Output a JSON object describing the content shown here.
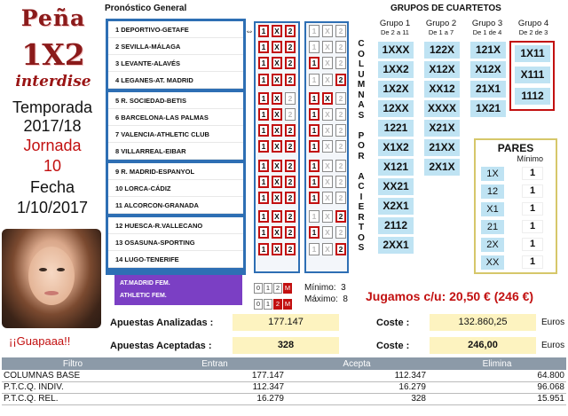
{
  "brand": {
    "line1": "Peña",
    "line2": "1X2",
    "line3": "interdise"
  },
  "info": {
    "temporada_label": "Temporada",
    "temporada": "2017/18",
    "jornada_label": "Jornada",
    "jornada": "10",
    "fecha_label": "Fecha",
    "fecha": "1/10/2017"
  },
  "guapa": "¡¡Guapaaa!!",
  "pronostico": {
    "title": "Pronóstico General",
    "matches": [
      "1  DEPORTIVO-GETAFE",
      "2  SEVILLA-MÁLAGA",
      "3  LEVANTE-ALAVÉS",
      "4  LEGANES-AT. MADRID",
      "5  R. SOCIEDAD-BETIS",
      "6  BARCELONA-LAS PALMAS",
      "7  VALENCIA-ATHLETIC CLUB",
      "8  VILLARREAL-EIBAR",
      "9  R. MADRID-ESPANYOL",
      "10  LORCA-CÁDIZ",
      "11  ALCORCON-GRANADA",
      "12  HUESCA-R.VALLECANO",
      "13  OSASUNA-SPORTING",
      "14  LUGO-TENERIFE"
    ],
    "fem": [
      "AT.MADRID FEM.",
      "ATHLETIC FEM."
    ],
    "arrow": "⇔",
    "signs": [
      [
        1,
        1,
        1
      ],
      [
        1,
        1,
        1
      ],
      [
        1,
        1,
        1
      ],
      [
        1,
        1,
        1
      ],
      [
        1,
        1,
        0
      ],
      [
        1,
        1,
        0
      ],
      [
        1,
        1,
        1
      ],
      [
        1,
        1,
        1
      ],
      [
        1,
        1,
        1
      ],
      [
        1,
        1,
        1
      ],
      [
        1,
        1,
        1
      ],
      [
        1,
        1,
        1
      ],
      [
        1,
        1,
        1
      ],
      [
        1,
        1,
        1
      ]
    ],
    "aciertos": [
      [
        0,
        0,
        0
      ],
      [
        0,
        0,
        0
      ],
      [
        1,
        0,
        0
      ],
      [
        0,
        0,
        1
      ],
      [
        1,
        1,
        0
      ],
      [
        1,
        0,
        0
      ],
      [
        1,
        0,
        0
      ],
      [
        1,
        0,
        0
      ],
      [
        1,
        0,
        0
      ],
      [
        1,
        0,
        0
      ],
      [
        1,
        0,
        0
      ],
      [
        0,
        0,
        1
      ],
      [
        1,
        0,
        0
      ],
      [
        0,
        0,
        1
      ]
    ],
    "fem_options": [
      [
        "0",
        "1",
        "2",
        "M"
      ],
      [
        "0",
        "1",
        "2",
        "M"
      ]
    ],
    "fem_highlight": [
      [
        3
      ],
      [
        2,
        3
      ]
    ]
  },
  "vertical_text": "COLUMNAS POR ACIERTOS",
  "grupos": {
    "title": "GRUPOS DE CUARTETOS",
    "headers": [
      {
        "name": "Grupo 1",
        "range": "De 2 a 11"
      },
      {
        "name": "Grupo 2",
        "range": "De 1 a 7"
      },
      {
        "name": "Grupo 3",
        "range": "De 1 de 4"
      },
      {
        "name": "Grupo 4",
        "range": "De 2 de 3"
      }
    ],
    "g1": [
      "1XXX",
      "1XX2",
      "1X2X",
      "12XX",
      "1221",
      "X1X2",
      "X121",
      "XX21",
      "X2X1",
      "2112",
      "2XX1"
    ],
    "g2": [
      "122X",
      "X12X",
      "XX12",
      "XXXX",
      "X21X",
      "21XX",
      "2X1X"
    ],
    "g3": [
      "121X",
      "X12X",
      "21X1",
      "1X21"
    ],
    "g4": [
      "1X11",
      "X111",
      "1112"
    ]
  },
  "pares": {
    "title": "PARES",
    "subtitle": "Mínimo",
    "rows": [
      [
        "1X",
        "1"
      ],
      [
        "12",
        "1"
      ],
      [
        "X1",
        "1"
      ],
      [
        "21",
        "1"
      ],
      [
        "2X",
        "1"
      ],
      [
        "XX",
        "1"
      ]
    ]
  },
  "minimo_label": "Mínimo:",
  "minimo": "3",
  "maximo_label": "Máximo:",
  "maximo": "8",
  "jugamos": "Jugamos c/u: 20,50 €  (246 €)",
  "summary": {
    "analizadas_label": "Apuestas Analizadas :",
    "analizadas": "177.147",
    "aceptadas_label": "Apuestas Aceptadas :",
    "aceptadas": "328",
    "coste_label": "Coste :",
    "coste1": "132.860,25",
    "coste2": "246,00",
    "euros": "Euros"
  },
  "table": {
    "headers": [
      "Filtro",
      "Entran",
      "Acepta",
      "Elimina"
    ],
    "rows": [
      [
        "COLUMNAS BASE",
        "177.147",
        "112.347",
        "64.800"
      ],
      [
        "P.T.C.Q. INDIV.",
        "112.347",
        "16.279",
        "96.068"
      ],
      [
        "P.T.C.Q. REL.",
        "16.279",
        "328",
        "15.951"
      ]
    ]
  }
}
